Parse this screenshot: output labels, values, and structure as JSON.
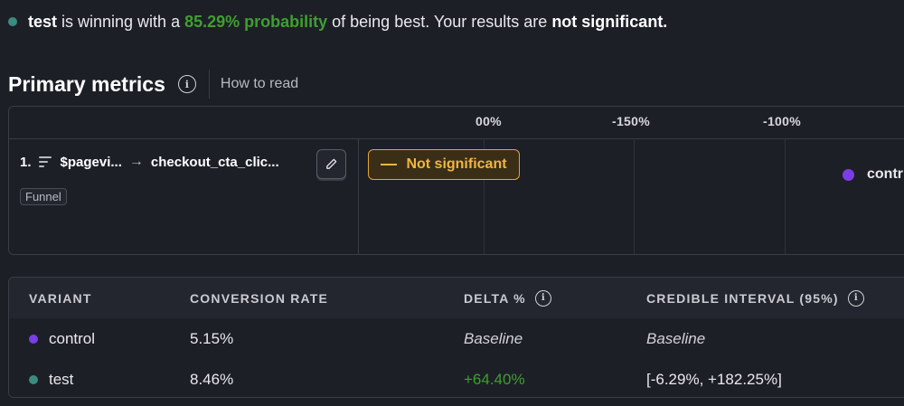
{
  "summary": {
    "variant": "test",
    "text_before": "is winning with a",
    "probability": "85.29% probability",
    "text_middle": "of being best. Your results are",
    "significance": "not significant."
  },
  "primary_metrics": {
    "title": "Primary metrics",
    "info_icon": "info-icon",
    "how_to_read": "How to read"
  },
  "chart": {
    "ticks": [
      "00%",
      "-150%",
      "-100%"
    ],
    "metric": {
      "number": "1.",
      "icon": "funnel-icon",
      "from_event": "$pagevi...",
      "arrow": "→",
      "to_event": "checkout_cta_clic...",
      "edit_icon": "pencil-icon",
      "type_tag": "Funnel",
      "significance_badge": "Not significant",
      "legend_label": "contr"
    }
  },
  "table": {
    "headers": [
      "VARIANT",
      "CONVERSION RATE",
      "DELTA %",
      "CREDIBLE INTERVAL (95%)"
    ],
    "rows": [
      {
        "variant": "control",
        "conversion_rate": "5.15%",
        "delta": "Baseline",
        "credible_interval": "Baseline"
      },
      {
        "variant": "test",
        "conversion_rate": "8.46%",
        "delta": "+64.40%",
        "credible_interval": "[-6.29%, +182.25%]"
      }
    ]
  },
  "colors": {
    "control": "#7b3ee6",
    "test": "#3b8b7e",
    "positive": "#3f9f2f",
    "warning": "#f0b542"
  }
}
